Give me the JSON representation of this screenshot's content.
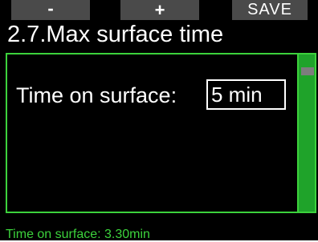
{
  "softkeys": {
    "minus": "-",
    "plus": "+",
    "save": "SAVE"
  },
  "title": "2.7.Max surface time",
  "setting": {
    "label": "Time on surface:",
    "value": "5 min"
  },
  "status": "Time on surface: 3.30min",
  "colors": {
    "accent": "#3cd23c",
    "scrollbar": "#1fa32a",
    "softkey_bg": "#4a4a4a",
    "background": "#000000"
  }
}
